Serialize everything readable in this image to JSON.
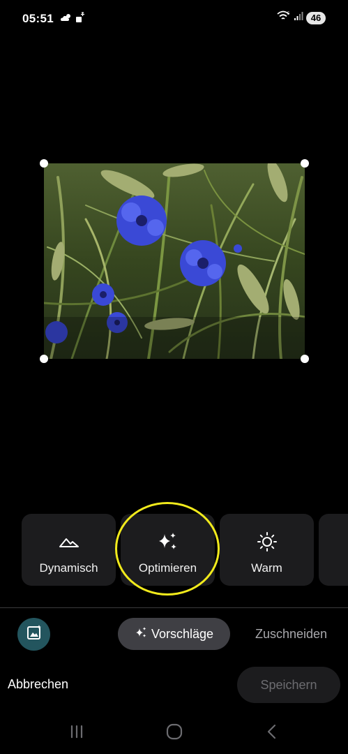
{
  "status_bar": {
    "time": "05:51",
    "battery_level": "46",
    "left_icons": [
      "weather-cloud-icon",
      "data-saver-icon"
    ],
    "right_icons": [
      "wifi-icon",
      "signal-icon"
    ]
  },
  "photo": {
    "subject": "blue cornflowers in a wheat field",
    "crop_handles": [
      "top-left",
      "top-right",
      "bottom-left",
      "bottom-right"
    ]
  },
  "filters": [
    {
      "label": "Dynamisch",
      "icon": "mountain-icon"
    },
    {
      "label": "Optimieren",
      "icon": "sparkle-icon"
    },
    {
      "label": "Warm",
      "icon": "sun-icon"
    }
  ],
  "tabs": {
    "suggestions_label": "Vorschläge",
    "crop_label": "Zuschneiden"
  },
  "actions": {
    "cancel_label": "Abbrechen",
    "save_label": "Speichern"
  },
  "navigation": [
    "recent-apps-icon",
    "home-icon",
    "back-icon"
  ],
  "colors": {
    "background": "#000000",
    "card": "#1c1c1e",
    "highlight": "#f1ea1c",
    "gallery_button": "#23555e",
    "active_tab": "#3f3f44"
  }
}
